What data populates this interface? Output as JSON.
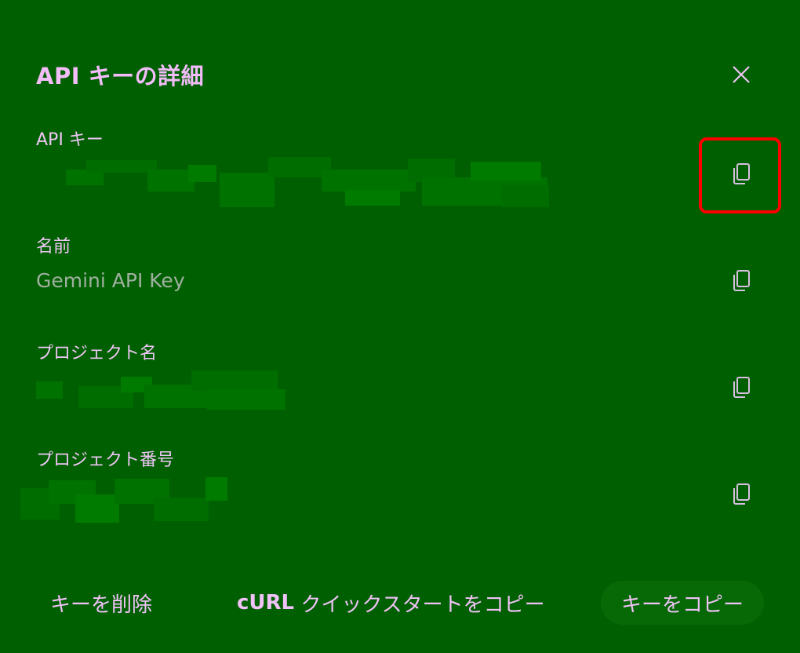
{
  "dialog": {
    "title": "API キーの詳細",
    "close_icon": "close-icon"
  },
  "fields": [
    {
      "label": "API キー",
      "value": "",
      "copy_icon": "copy-icon"
    },
    {
      "label": "名前",
      "value": "Gemini API Key",
      "copy_icon": "copy-icon"
    },
    {
      "label": "プロジェクト名",
      "value": "",
      "copy_icon": "copy-icon"
    },
    {
      "label": "プロジェクト番号",
      "value": "",
      "copy_icon": "copy-icon"
    }
  ],
  "footer": {
    "delete_label": "キーを削除",
    "curl_prefix": "cURL",
    "curl_suffix": " クイックスタートをコピー",
    "copy_key_label": "キーをコピー"
  },
  "colors": {
    "background": "#005f00",
    "text": "#f0c4f8",
    "highlight": "#ff0000"
  }
}
